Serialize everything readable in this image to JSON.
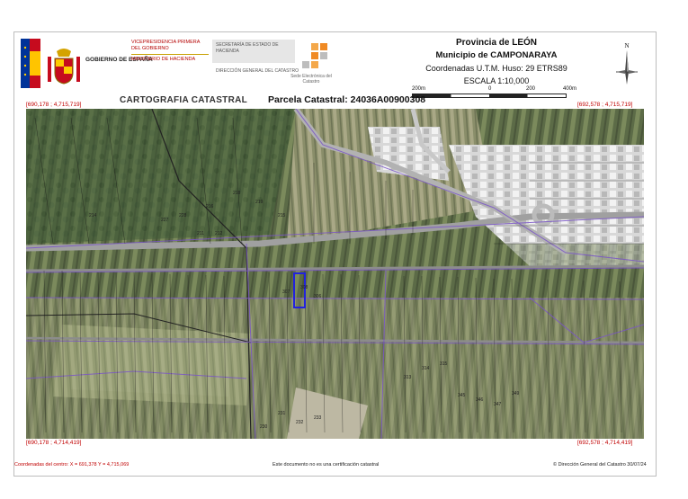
{
  "header": {
    "gobierno": "GOBIERNO DE ESPAÑA",
    "vicepresidencia": "VICEPRESIDENCIA PRIMERA DEL GOBIERNO",
    "ministerio": "MINISTERIO DE HACIENDA",
    "secretaria": "SECRETARÍA DE ESTADO DE HACIENDA",
    "direccion": "DIRECCIÓN GENERAL DEL CATASTRO",
    "sede": "Sede Electrónica del Catastro",
    "provincia": "Provincia de LEÓN",
    "municipio": "Municipio de CAMPONARAYA",
    "coordenadas": "Coordenadas U.T.M. Huso: 29 ETRS89",
    "escala": "ESCALA 1:10,000",
    "scale_ticks": [
      "200m",
      "0",
      "200",
      "400m"
    ],
    "north_label": "N"
  },
  "titles": {
    "cartografia": "CARTOGRAFIA CATASTRAL",
    "parcela": "Parcela Catastral: 24036A00900308"
  },
  "corners": {
    "top_left": "[690,178 ; 4,715,719]",
    "top_right": "[692,578 ; 4,715,719]",
    "bottom_left": "[690,178 ; 4,714,419]",
    "bottom_right": "[692,578 ; 4,714,419]"
  },
  "footer": {
    "center_coords": "Coordenadas del centro: X = 691,378 Y = 4,715,069",
    "disclaimer": "Este documento no es una certificación catastral",
    "copyright": "© Dirección General del Catastro 30/07/24"
  },
  "colors": {
    "red_text": "#c00000",
    "parcel_lines": "#7a55c8",
    "highlight_parcel": "#2222dd",
    "road": "#9c9c9c"
  },
  "parcel_labels": [
    "214",
    "215",
    "216",
    "218",
    "219",
    "230",
    "231",
    "232",
    "233",
    "313",
    "314",
    "315",
    "345",
    "346",
    "347",
    "349",
    "308",
    "307",
    "306",
    "227",
    "228",
    "211",
    "212"
  ]
}
